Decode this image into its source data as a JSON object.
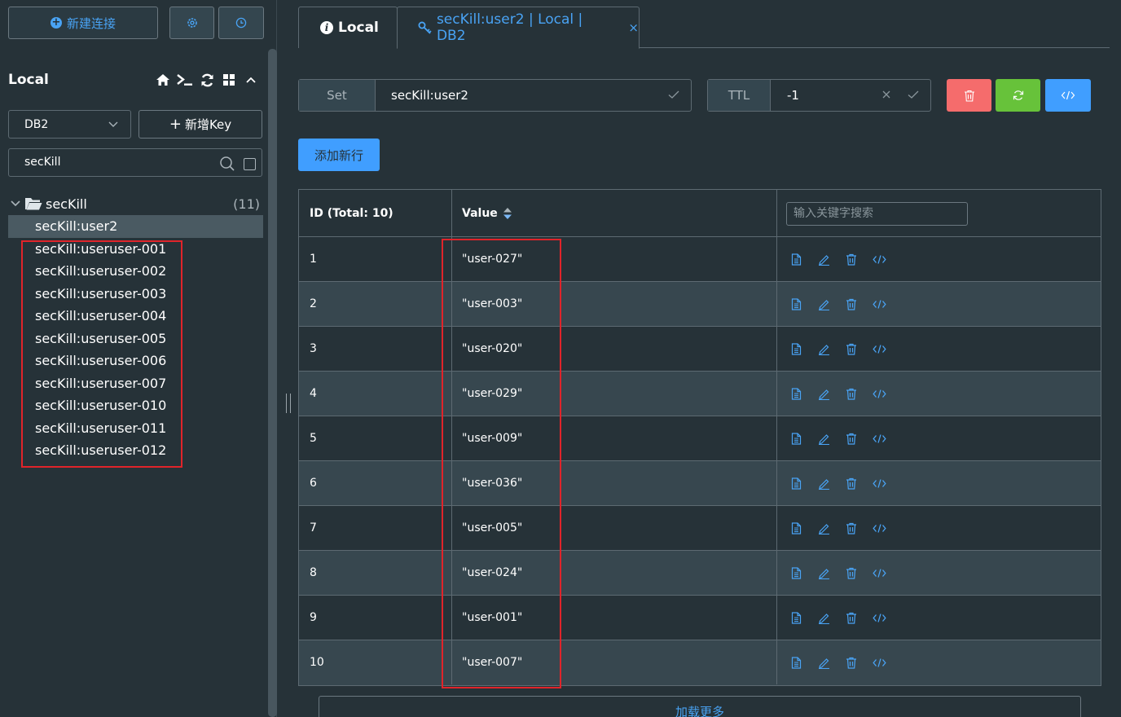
{
  "sidebar": {
    "new_connection_label": "新建连接",
    "connection_name": "Local",
    "db_select_value": "DB2",
    "new_key_label": "新增Key",
    "search_value": "secKill",
    "tree": {
      "folder_name": "secKill",
      "folder_count": "(11)",
      "keys": [
        "secKill:user2",
        "secKill:useruser-001",
        "secKill:useruser-002",
        "secKill:useruser-003",
        "secKill:useruser-004",
        "secKill:useruser-005",
        "secKill:useruser-006",
        "secKill:useruser-007",
        "secKill:useruser-010",
        "secKill:useruser-011",
        "secKill:useruser-012"
      ],
      "selected_key": "secKill:user2"
    }
  },
  "tabs": {
    "local_label": "Local",
    "key_tab_label": "secKill:user2 | Local | DB2",
    "close_symbol": "×"
  },
  "key_header": {
    "type_label": "Set",
    "key_name": "secKill:user2",
    "ttl_label": "TTL",
    "ttl_value": "-1"
  },
  "add_row_label": "添加新行",
  "table": {
    "col_id": "ID (Total: 10)",
    "col_value": "Value",
    "search_placeholder": "输入关键字搜索",
    "rows": [
      {
        "id": "1",
        "value": "\"user-027\""
      },
      {
        "id": "2",
        "value": "\"user-003\""
      },
      {
        "id": "3",
        "value": "\"user-020\""
      },
      {
        "id": "4",
        "value": "\"user-029\""
      },
      {
        "id": "5",
        "value": "\"user-009\""
      },
      {
        "id": "6",
        "value": "\"user-036\""
      },
      {
        "id": "7",
        "value": "\"user-005\""
      },
      {
        "id": "8",
        "value": "\"user-024\""
      },
      {
        "id": "9",
        "value": "\"user-001\""
      },
      {
        "id": "10",
        "value": "\"user-007\""
      }
    ]
  },
  "load_more_label": "加载更多",
  "colors": {
    "accent": "#409eff",
    "danger": "#f56c6c",
    "success": "#67c23a",
    "highlight_box": "#e0242a",
    "background": "#263238"
  },
  "icons": [
    "plus-circle-icon",
    "settings-icon",
    "history-icon",
    "home-icon",
    "terminal-icon",
    "refresh-icon",
    "grid-icon",
    "chevron-up-icon",
    "chevron-down-icon",
    "search-icon",
    "folder-icon",
    "info-icon",
    "key-icon",
    "check-icon",
    "clear-icon",
    "delete-icon",
    "code-icon",
    "sort-icon",
    "document-icon",
    "edit-icon"
  ]
}
